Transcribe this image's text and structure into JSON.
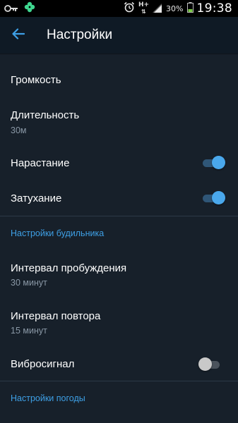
{
  "status_bar": {
    "notification_icons": [
      "key-icon",
      "clover-icon"
    ],
    "network_type": "H+",
    "battery_percent": "30%",
    "time": "19:38"
  },
  "app_bar": {
    "back_icon": "arrow-left-icon",
    "title": "Настройки"
  },
  "settings": {
    "volume": {
      "title": "Громкость"
    },
    "duration": {
      "title": "Длительность",
      "value": "30м"
    },
    "fade_in": {
      "title": "Нарастание",
      "enabled": true
    },
    "fade_out": {
      "title": "Затухание",
      "enabled": true
    },
    "alarm_section": "Настройки будильника",
    "wake_interval": {
      "title": "Интервал пробуждения",
      "value": "30 минут"
    },
    "repeat_interval": {
      "title": "Интервал повтора",
      "value": "15 минут"
    },
    "vibration": {
      "title": "Вибросигнал",
      "enabled": false
    },
    "weather_section": "Настройки погоды"
  },
  "colors": {
    "background": "#17202a",
    "app_bar": "#0f1a25",
    "accent": "#3ea0e6",
    "secondary_text": "#8a98a6"
  }
}
